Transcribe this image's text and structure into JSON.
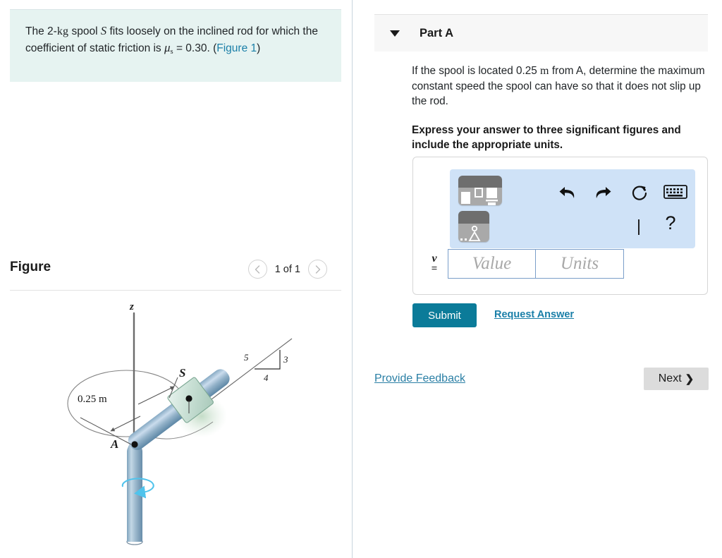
{
  "problem": {
    "lead": "The 2-",
    "unit_kg": "kg",
    "mid1": " spool ",
    "symbol_S": "S",
    "mid2": " fits loosely on the inclined rod for which the coefficient of static friction is ",
    "mu": "μ",
    "mu_sub": "s",
    "mid3": " = 0.30. (",
    "figure_link": "Figure 1",
    "tail": ")"
  },
  "figure": {
    "title": "Figure",
    "pager": {
      "prev_icon": "chevron-left-icon",
      "label": "1 of 1",
      "next_icon": "chevron-right-icon"
    },
    "diagram": {
      "axis_label": "z",
      "point_a": "A",
      "spool_label": "S",
      "distance_label": "0.25 m",
      "slope": {
        "hyp": "5",
        "vert": "3",
        "horiz": "4"
      },
      "rod_color": "#8fb0c9",
      "rod_dark": "#5d87a6",
      "collar_color": "#cfe2d8",
      "spin_arrow_color": "#29b6e8"
    }
  },
  "part": {
    "caret_icon": "caret-down-icon",
    "title": "Part A",
    "question": "If the spool is located 0.25 m from A, determine the maximum constant speed the spool can have so that it does not slip up the rod.",
    "question_pre": "If the spool is located 0.25 ",
    "question_unit": "m",
    "question_post": " from A, determine the maximum constant speed the spool can have so that it does not slip up the rod.",
    "instruction": "Express your answer to three significant figures and include the appropriate units."
  },
  "answer": {
    "toolbar": {
      "template_matrix_icon": "math-template-icon",
      "template_symbols_icon": "math-symbols-icon",
      "undo_icon": "undo-icon",
      "redo_icon": "redo-icon",
      "reset_icon": "reset-icon",
      "keyboard_icon": "keyboard-icon",
      "cursor_icon": "text-cursor-icon",
      "help_icon": "help-icon",
      "help_glyph": "?",
      "cursor_glyph": "|",
      "background": "#cfe2f7"
    },
    "variable_symbol": "v",
    "equals_symbol": "=",
    "value_placeholder": "Value",
    "units_placeholder": "Units",
    "value_current": "",
    "units_current": ""
  },
  "actions": {
    "submit_label": "Submit",
    "request_answer_label": "Request Answer",
    "provide_feedback_label": "Provide Feedback",
    "next_label": "Next",
    "next_chevron": "❯"
  },
  "colors": {
    "problem_bg": "#e6f3f1",
    "accent_teal": "#0b7b99",
    "link_blue": "#1a7fa8",
    "header_gray": "#f7f7f7"
  }
}
